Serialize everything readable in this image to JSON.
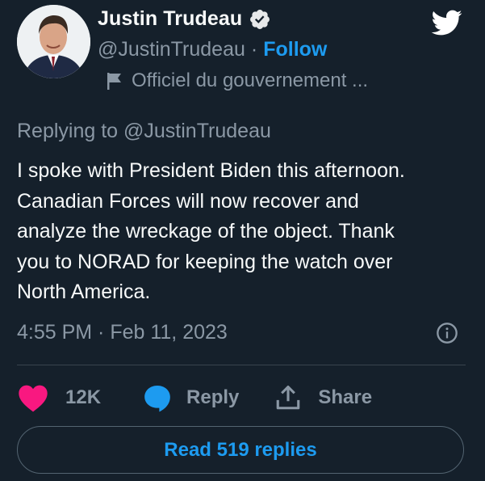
{
  "author": {
    "name": "Justin Trudeau",
    "handle": "@JustinTrudeau",
    "separator": "·",
    "follow_label": "Follow",
    "account_label": "Officiel du gouvernement ...",
    "verified": true
  },
  "tweet": {
    "replying_to": "Replying to @JustinTrudeau",
    "text_lines": [
      "I spoke with President Biden this afternoon.",
      "Canadian Forces will now recover and",
      "analyze the wreckage of the object. Thank",
      "you to NORAD for keeping the watch over",
      "North America."
    ],
    "timestamp": "4:55 PM · Feb 11, 2023"
  },
  "actions": {
    "like_count": "12K",
    "reply_label": "Reply",
    "share_label": "Share"
  },
  "footer": {
    "read_replies_label": "Read 519 replies"
  },
  "icons": {
    "twitter": "twitter-bird-icon",
    "verified": "verified-badge-icon",
    "flag": "flag-icon",
    "info": "info-icon",
    "like": "heart-icon",
    "reply": "reply-bubble-icon",
    "share": "share-icon"
  },
  "colors": {
    "background": "#15202b",
    "text": "#f7f9f9",
    "muted": "#8b98a5",
    "accent": "#1d9bf0",
    "like": "#f91880",
    "border": "#38444d"
  }
}
